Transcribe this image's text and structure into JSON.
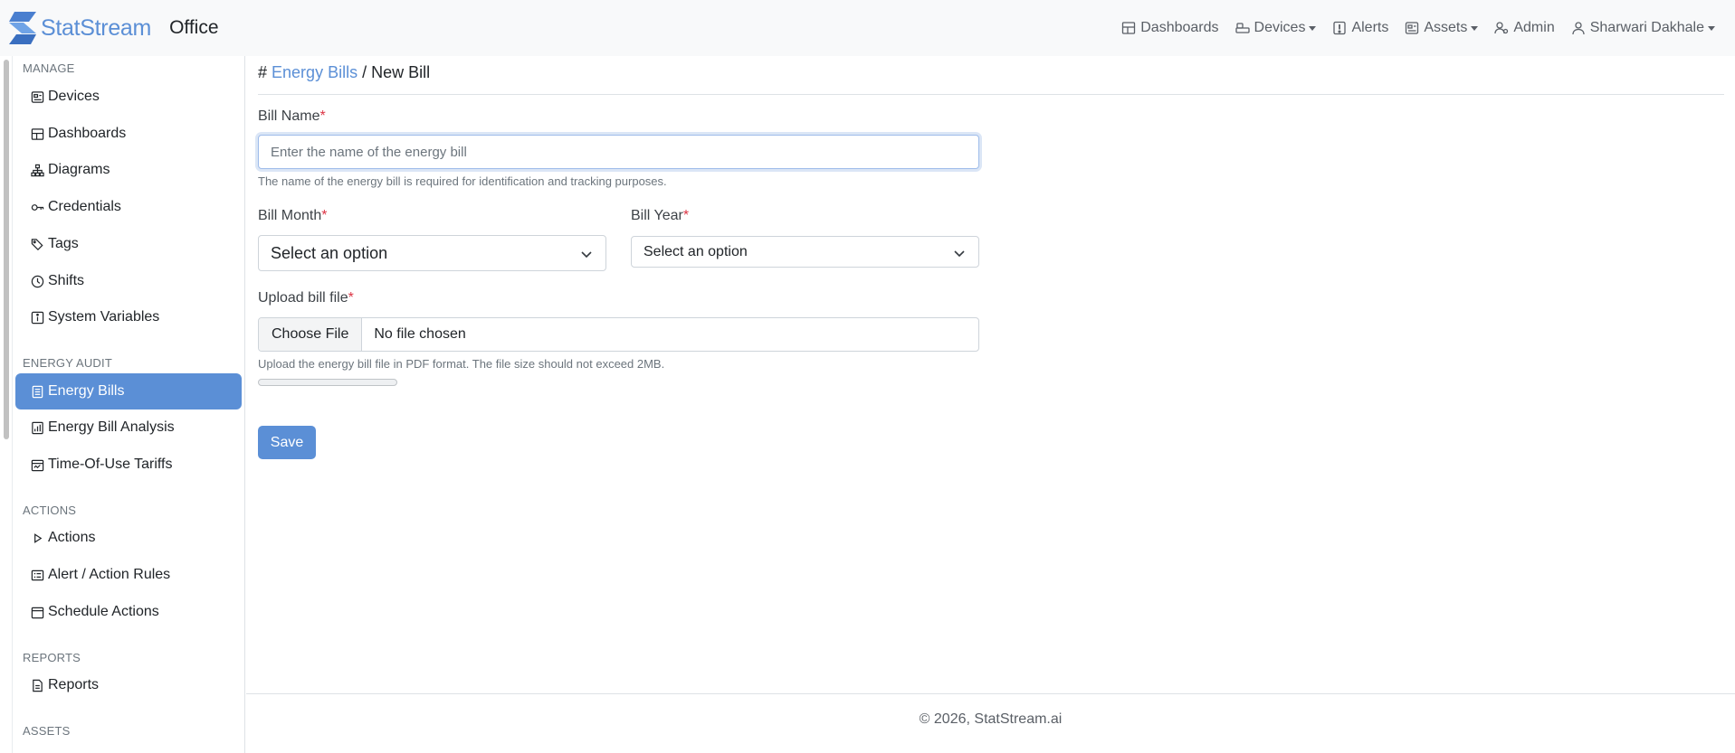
{
  "app": {
    "brand": "StatStream",
    "site": "Office"
  },
  "topnav": {
    "items": [
      {
        "label": "Dashboards",
        "icon": "dashboard-icon"
      },
      {
        "label": "Devices",
        "icon": "devices-icon",
        "dropdown": true
      },
      {
        "label": "Alerts",
        "icon": "alert-icon"
      },
      {
        "label": "Assets",
        "icon": "assets-icon",
        "dropdown": true
      },
      {
        "label": "Admin",
        "icon": "admin-icon"
      },
      {
        "label": "Sharwari Dakhale",
        "icon": "user-icon",
        "dropdown": true
      }
    ]
  },
  "sidebar": {
    "sections": [
      {
        "title": "MANAGE",
        "items": [
          {
            "label": "Devices",
            "icon": "devices-icon"
          },
          {
            "label": "Dashboards",
            "icon": "dashboard-icon"
          },
          {
            "label": "Diagrams",
            "icon": "diagram-icon"
          },
          {
            "label": "Credentials",
            "icon": "key-icon"
          },
          {
            "label": "Tags",
            "icon": "tags-icon"
          },
          {
            "label": "Shifts",
            "icon": "clock-icon"
          },
          {
            "label": "System Variables",
            "icon": "info-icon"
          }
        ]
      },
      {
        "title": "ENERGY AUDIT",
        "items": [
          {
            "label": "Energy Bills",
            "icon": "bill-icon",
            "active": true
          },
          {
            "label": "Energy Bill Analysis",
            "icon": "chart-icon"
          },
          {
            "label": "Time-Of-Use Tariffs",
            "icon": "calendar-icon"
          }
        ]
      },
      {
        "title": "ACTIONS",
        "items": [
          {
            "label": "Actions",
            "icon": "play-icon"
          },
          {
            "label": "Alert / Action Rules",
            "icon": "rules-icon"
          },
          {
            "label": "Schedule Actions",
            "icon": "calendar-icon"
          }
        ]
      },
      {
        "title": "REPORTS",
        "items": [
          {
            "label": "Reports",
            "icon": "report-icon"
          }
        ]
      },
      {
        "title": "ASSETS",
        "items": []
      }
    ]
  },
  "breadcrumb": {
    "prefix": "#",
    "parent": "Energy Bills",
    "separator": "/",
    "current": "New Bill"
  },
  "form": {
    "bill_name": {
      "label": "Bill Name",
      "required_mark": "*",
      "placeholder": "Enter the name of the energy bill",
      "value": "",
      "help": "The name of the energy bill is required for identification and tracking purposes."
    },
    "bill_month": {
      "label": "Bill Month",
      "required_mark": "*",
      "selected": "Select an option"
    },
    "bill_year": {
      "label": "Bill Year",
      "required_mark": "*",
      "selected": "Select an option"
    },
    "upload": {
      "label": "Upload bill file",
      "required_mark": "*",
      "button_label": "Choose File",
      "file_status": "No file chosen",
      "help": "Upload the energy bill file in PDF format. The file size should not exceed 2MB.",
      "progress": 0
    },
    "save_label": "Save"
  },
  "footer": {
    "text": "© 2026, StatStream.ai"
  },
  "colors": {
    "accent": "#5b8fd6",
    "required": "#dc3545"
  }
}
